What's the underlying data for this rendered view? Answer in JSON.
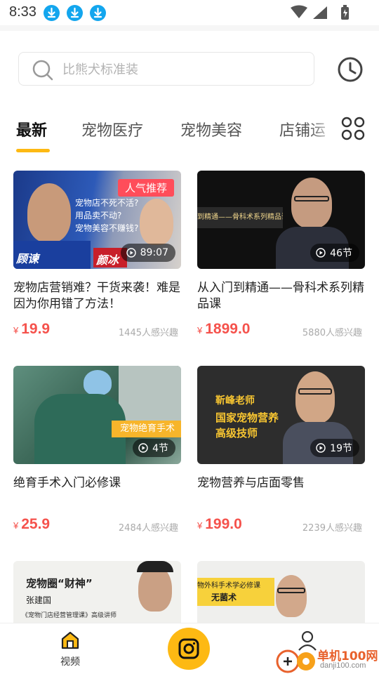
{
  "status_bar": {
    "time": "8:33"
  },
  "search": {
    "placeholder": "比熊犬标准装"
  },
  "tabs": [
    {
      "label": "最新",
      "active": true
    },
    {
      "label": "宠物医疗",
      "active": false
    },
    {
      "label": "宠物美容",
      "active": false
    },
    {
      "label": "店铺运",
      "active": false
    }
  ],
  "courses": [
    {
      "title": "宠物店营销难？干货来袭！难是因为你用错了方法！",
      "currency": "¥",
      "price": "19.9",
      "interest": "1445人感兴趣",
      "badge": "人气推荐",
      "duration": "89:07",
      "thumb_text": [
        "宠物店不死不活?",
        "用品卖不动?",
        "宠物美容不赚钱?"
      ],
      "thumb_name_left": "顾谏",
      "thumb_name_right": "颜冰"
    },
    {
      "title": "从入门到精通——骨科术系列精品课",
      "currency": "¥",
      "price": "1899.0",
      "interest": "5880人感兴趣",
      "duration": "46节",
      "thumb_text": [
        "到精通——骨科术系列精品课"
      ]
    },
    {
      "title": "绝育手术入门必修课",
      "currency": "¥",
      "price": "25.9",
      "interest": "2484人感兴趣",
      "duration": "4节",
      "thumb_text": [
        "宠物绝育手术"
      ]
    },
    {
      "title": "宠物营养与店面零售",
      "currency": "¥",
      "price": "199.0",
      "interest": "2239人感兴趣",
      "duration": "19节",
      "thumb_text": [
        "靳峰老师",
        "国家宠物营养",
        "高级技师"
      ]
    },
    {
      "title": "",
      "thumb_text": [
        "宠物圈“财神”",
        "张建国",
        "《宠物门店经营管理课》高级讲师"
      ]
    },
    {
      "title": "",
      "thumb_text": [
        "物外科手术学必修课",
        "无菌术"
      ]
    }
  ],
  "bottom_nav": {
    "video_label": "视频"
  },
  "watermark": {
    "line1": "单机100网",
    "line2": "danji100.com"
  },
  "colors": {
    "accent": "#fdb913",
    "price": "#f5524c",
    "badge": "#ff4d5a",
    "download": "#13a6ee"
  }
}
